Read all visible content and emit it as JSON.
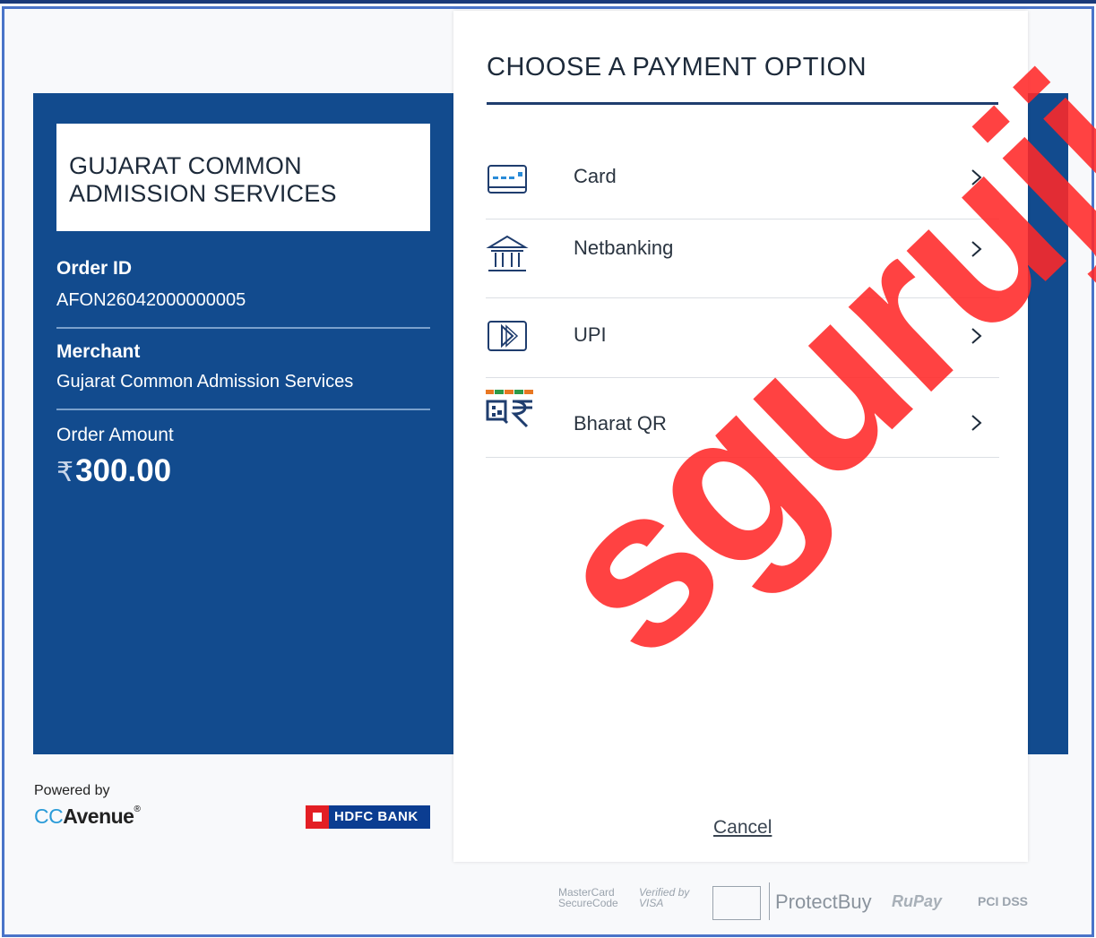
{
  "merchant_panel": {
    "brand_name": "GUJARAT COMMON ADMISSION SERVICES",
    "order_id_label": "Order ID",
    "order_id_value": "AFON26042000000005",
    "merchant_label": "Merchant",
    "merchant_value": "Gujarat Common Admission Services",
    "amount_label": "Order Amount",
    "currency_symbol": "₹",
    "amount_value": "300.00"
  },
  "payment_panel": {
    "title": "CHOOSE A PAYMENT OPTION",
    "options": [
      {
        "label": "Card",
        "icon": "card-icon"
      },
      {
        "label": "Netbanking",
        "icon": "bank-icon"
      },
      {
        "label": "UPI",
        "icon": "upi-icon"
      },
      {
        "label": "Bharat QR",
        "icon": "bharat-qr-icon"
      }
    ],
    "cancel_label": "Cancel"
  },
  "footer": {
    "powered_by": "Powered by",
    "ccavenue_cc": "CC",
    "ccavenue_rest": "Avenue",
    "hdfc_label": "HDFC BANK",
    "badges": {
      "mastercard": "MasterCard SecureCode",
      "visa": "Verified by VISA",
      "protectbuy": "ProtectBuy",
      "rupay": "RuPay",
      "pci": "PCI DSS"
    }
  },
  "watermark": "sguruji",
  "colors": {
    "panel_blue": "#124b8e",
    "frame_blue": "#4a74c9",
    "watermark_red": "#ff2828"
  }
}
